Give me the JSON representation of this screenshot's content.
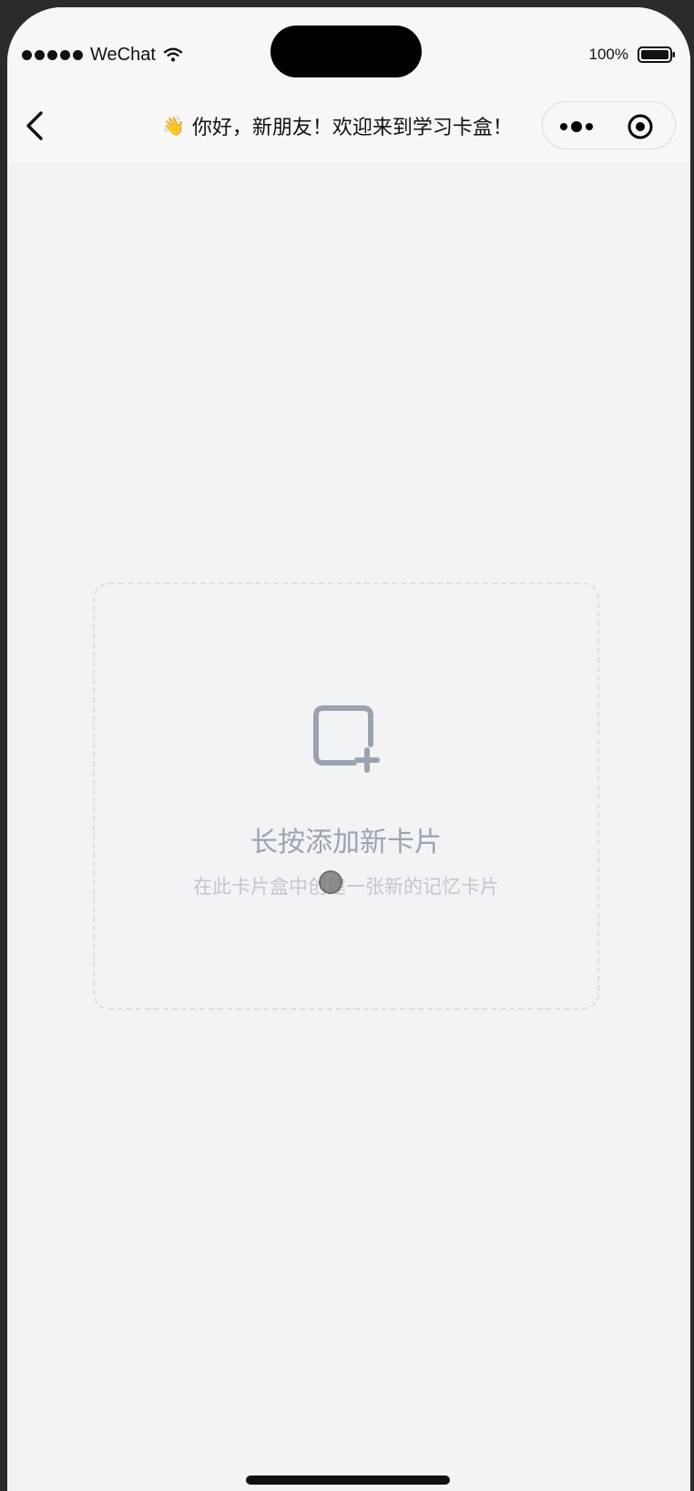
{
  "status_bar": {
    "carrier": "WeChat",
    "battery": "100%",
    "icons": [
      "signal-dots-icon",
      "wifi-icon",
      "battery-icon"
    ]
  },
  "nav": {
    "back_icon": "chevron-left-icon",
    "title_emoji": "👋",
    "title": "你好，新朋友！欢迎来到学习卡盒！",
    "capsule_icons": [
      "more-dots-icon",
      "target-close-icon"
    ]
  },
  "add_card": {
    "icon": "square-plus-icon",
    "title": "长按添加新卡片",
    "subtitle": "在此卡片盒中创建一张新的记忆卡片"
  },
  "colors": {
    "page_bg": "#f2f3f5",
    "nav_bg": "#f7f7f7",
    "card_border": "#dcdfe4",
    "icon_gray": "#9ca3af",
    "subtitle_gray": "#c2c6cd"
  }
}
